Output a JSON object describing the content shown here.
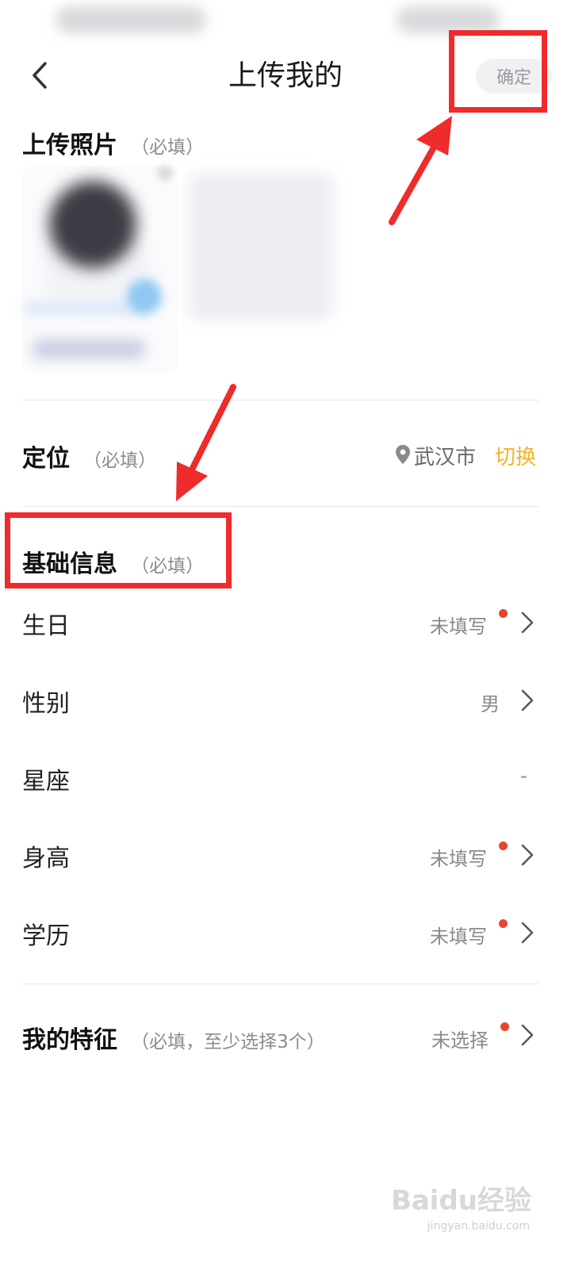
{
  "header": {
    "title": "上传我的",
    "confirm_label": "确定"
  },
  "photo_section": {
    "title": "上传照片",
    "required_hint": "（必填）"
  },
  "location_section": {
    "title": "定位",
    "required_hint": "（必填）",
    "city": "武汉市",
    "switch_label": "切换",
    "icon": "location-pin-icon"
  },
  "basic_info": {
    "title": "基础信息",
    "required_hint": "（必填）",
    "rows": [
      {
        "label": "生日",
        "value": "未填写",
        "unfilled": true
      },
      {
        "label": "性别",
        "value": "男",
        "unfilled": false
      },
      {
        "label": "星座",
        "value": "-",
        "unfilled": false
      },
      {
        "label": "身高",
        "value": "未填写",
        "unfilled": true
      },
      {
        "label": "学历",
        "value": "未填写",
        "unfilled": true
      }
    ]
  },
  "traits_section": {
    "title": "我的特征",
    "required_hint": "（必填，至少选择3个）",
    "value": "未选择"
  },
  "watermark": {
    "brand": "Baidu经验",
    "url": "jingyan.baidu.com"
  },
  "colors": {
    "accent": "#f0b429",
    "annotation_red": "#ef2b2b",
    "unfilled_dot": "#e8452f"
  }
}
